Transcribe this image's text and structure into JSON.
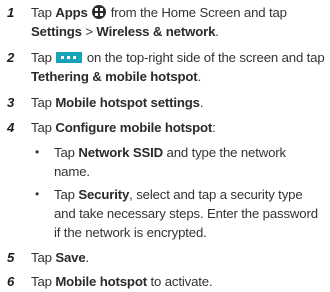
{
  "steps": [
    {
      "num": "1",
      "pre": "Tap ",
      "b1": "Apps",
      "mid": " from the Home Screen and tap ",
      "b2": "Settings",
      "sep": " > ",
      "b3": "Wireless & network",
      "post": "."
    },
    {
      "num": "2",
      "pre": "Tap ",
      "mid": " on the top-right side of the screen and tap ",
      "b1": "Tethering & mobile hotspot",
      "post": "."
    },
    {
      "num": "3",
      "pre": "Tap ",
      "b1": "Mobile hotspot settings",
      "post": "."
    },
    {
      "num": "4",
      "pre": "Tap ",
      "b1": "Configure mobile hotspot",
      "post": ":"
    },
    {
      "num": "5",
      "pre": "Tap ",
      "b1": "Save",
      "post": "."
    },
    {
      "num": "6",
      "pre": "Tap ",
      "b1": "Mobile hotspot",
      "post": " to activate."
    }
  ],
  "substeps": [
    {
      "bullet": "•",
      "pre": "Tap ",
      "b1": "Network SSID",
      "post": " and type the network name."
    },
    {
      "bullet": "•",
      "pre": "Tap ",
      "b1": "Security",
      "post": ", select and tap a security type and take necessary steps. Enter the password if the network is encrypted."
    }
  ],
  "icons": {
    "apps": "apps-grid-icon",
    "menu": "more-options-icon"
  },
  "colors": {
    "menu_icon": "#17a3b8",
    "apps_icon": "#2b2b2b"
  }
}
